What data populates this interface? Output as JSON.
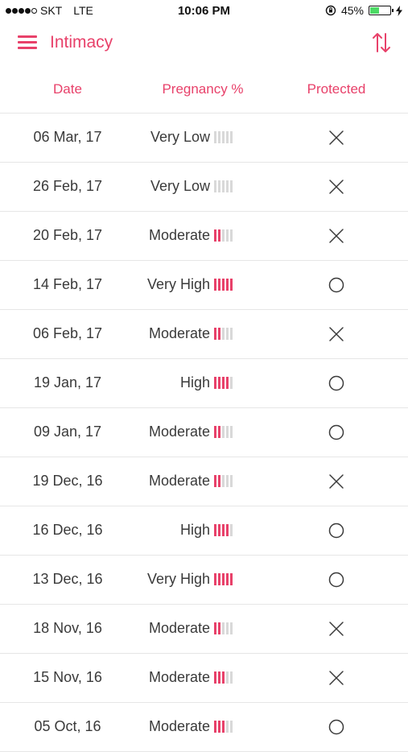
{
  "status_bar": {
    "carrier": "SKT",
    "network": "LTE",
    "time": "10:06 PM",
    "battery": "45%",
    "battery_level": 0.45,
    "signal_bars": 4,
    "signal_max": 5
  },
  "header": {
    "title": "Intimacy",
    "menu_icon": "hamburger-menu-icon",
    "sort_icon": "sort-arrows-icon"
  },
  "colors": {
    "accent": "#e8416a",
    "bar_off": "#d9d9d9",
    "divider": "#e6e6e6"
  },
  "table": {
    "columns": [
      "Date",
      "Pregnancy %",
      "Protected"
    ],
    "rows": [
      {
        "date": "06 Mar, 17",
        "level": "Very Low",
        "bars": 0,
        "protected": "no"
      },
      {
        "date": "26 Feb, 17",
        "level": "Very Low",
        "bars": 0,
        "protected": "no"
      },
      {
        "date": "20 Feb, 17",
        "level": "Moderate",
        "bars": 2,
        "protected": "no"
      },
      {
        "date": "14 Feb, 17",
        "level": "Very High",
        "bars": 5,
        "protected": "yes"
      },
      {
        "date": "06 Feb, 17",
        "level": "Moderate",
        "bars": 2,
        "protected": "no"
      },
      {
        "date": "19 Jan, 17",
        "level": "High",
        "bars": 4,
        "protected": "yes"
      },
      {
        "date": "09 Jan, 17",
        "level": "Moderate",
        "bars": 2,
        "protected": "yes"
      },
      {
        "date": "19 Dec, 16",
        "level": "Moderate",
        "bars": 2,
        "protected": "no"
      },
      {
        "date": "16 Dec, 16",
        "level": "High",
        "bars": 4,
        "protected": "yes"
      },
      {
        "date": "13 Dec, 16",
        "level": "Very High",
        "bars": 5,
        "protected": "yes"
      },
      {
        "date": "18 Nov, 16",
        "level": "Moderate",
        "bars": 2,
        "protected": "no"
      },
      {
        "date": "15 Nov, 16",
        "level": "Moderate",
        "bars": 3,
        "protected": "no"
      },
      {
        "date": "05 Oct, 16",
        "level": "Moderate",
        "bars": 3,
        "protected": "yes"
      }
    ],
    "bars_max": 5,
    "protected_yes_icon": "circle-icon",
    "protected_no_icon": "cross-icon"
  }
}
